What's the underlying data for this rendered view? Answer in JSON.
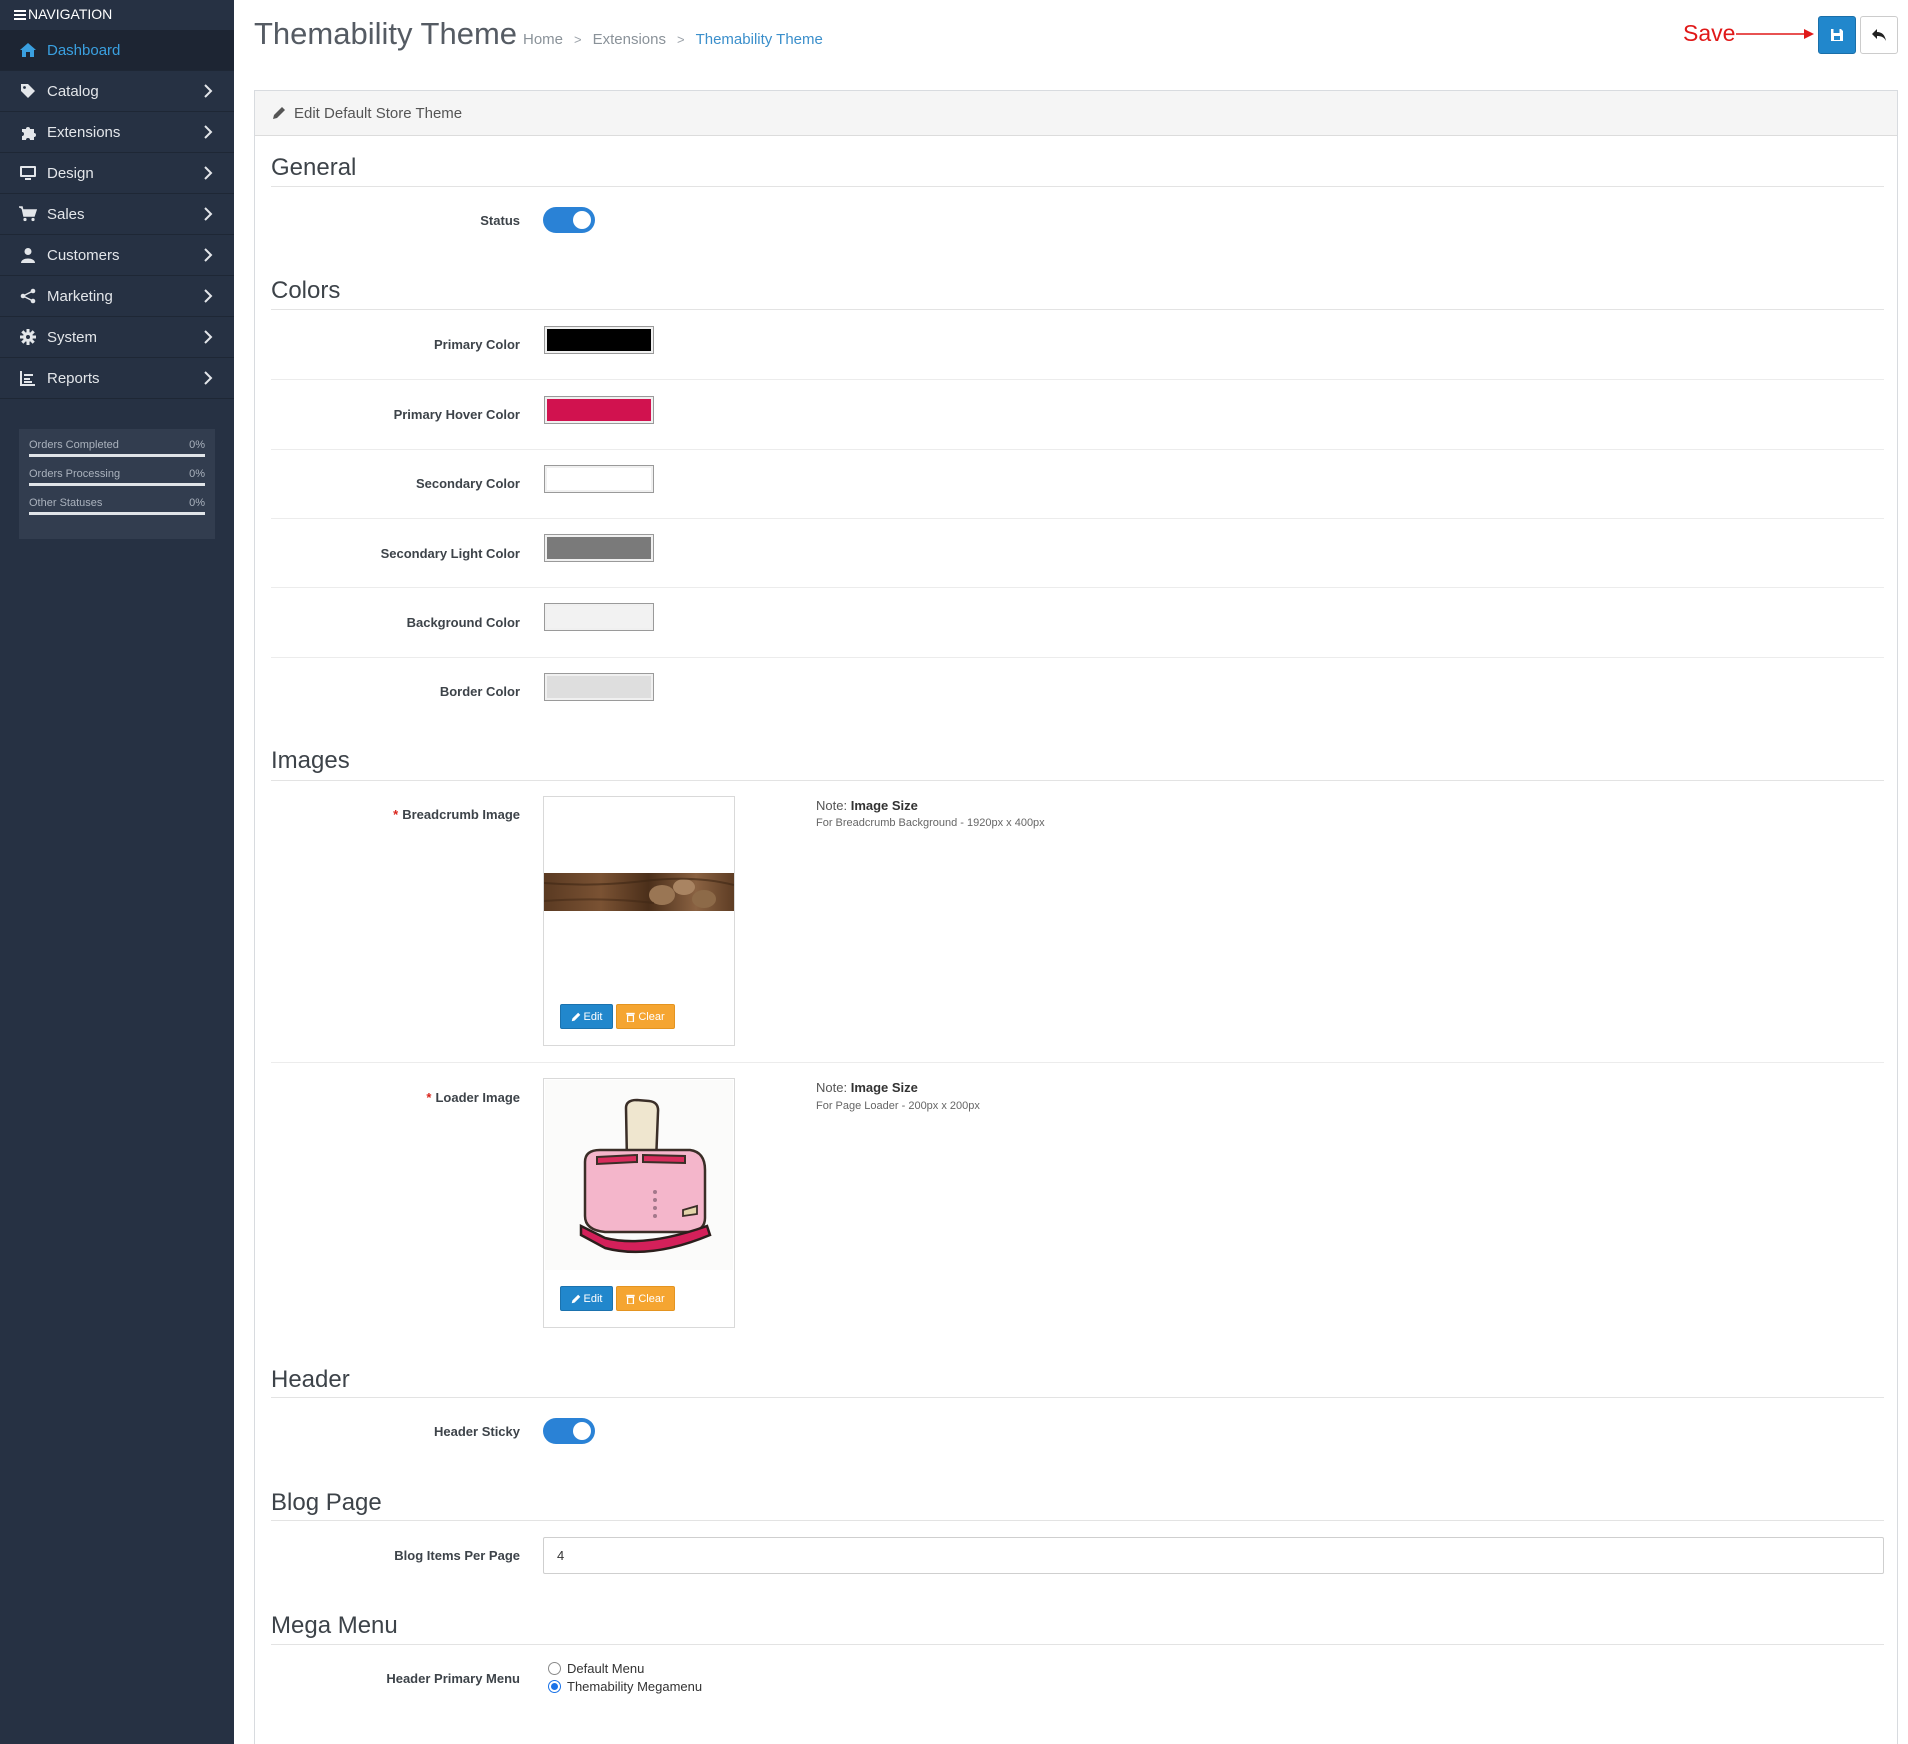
{
  "sidebar": {
    "title": "NAVIGATION",
    "items": [
      {
        "label": "Dashboard",
        "icon": "home-icon",
        "active": true
      },
      {
        "label": "Catalog",
        "icon": "tag-icon"
      },
      {
        "label": "Extensions",
        "icon": "puzzle-icon"
      },
      {
        "label": "Design",
        "icon": "monitor-icon"
      },
      {
        "label": "Sales",
        "icon": "cart-icon"
      },
      {
        "label": "Customers",
        "icon": "user-icon"
      },
      {
        "label": "Marketing",
        "icon": "share-icon"
      },
      {
        "label": "System",
        "icon": "gear-icon"
      },
      {
        "label": "Reports",
        "icon": "bar-chart-icon"
      }
    ],
    "stats": [
      {
        "label": "Orders Completed",
        "value": "0%",
        "progress": 0
      },
      {
        "label": "Orders Processing",
        "value": "0%",
        "progress": 0
      },
      {
        "label": "Other Statuses",
        "value": "0%",
        "progress": 0
      }
    ]
  },
  "header": {
    "title": "Themability Theme",
    "breadcrumb": [
      "Home",
      "Extensions",
      "Themability Theme"
    ],
    "save_annotation": "Save"
  },
  "panel": {
    "heading": "Edit Default Store Theme"
  },
  "general": {
    "title": "General",
    "status_label": "Status",
    "status_on": true
  },
  "colors": {
    "title": "Colors",
    "items": [
      {
        "label": "Primary Color",
        "value": "#000000"
      },
      {
        "label": "Primary Hover Color",
        "value": "#d1124f"
      },
      {
        "label": "Secondary Color",
        "value": "#ffffff"
      },
      {
        "label": "Secondary Light Color",
        "value": "#7a7a7a"
      },
      {
        "label": "Background Color",
        "value": "#f2f2f2"
      },
      {
        "label": "Border Color",
        "value": "#dedede"
      }
    ]
  },
  "images": {
    "title": "Images",
    "edit_label": "Edit",
    "clear_label": "Clear",
    "breadcrumb_image": {
      "label": "Breadcrumb Image",
      "note_prefix": "Note:",
      "note_bold": "Image Size",
      "note_detail": "For Breadcrumb Background - 1920px x 400px"
    },
    "loader_image": {
      "label": "Loader Image",
      "note_prefix": "Note:",
      "note_bold": "Image Size",
      "note_detail": "For Page Loader - 200px x 200px"
    }
  },
  "header_section": {
    "title": "Header",
    "sticky_label": "Header Sticky",
    "sticky_on": true
  },
  "blog": {
    "title": "Blog Page",
    "items_label": "Blog Items Per Page",
    "items_value": "4"
  },
  "mega_menu": {
    "title": "Mega Menu",
    "primary_label": "Header Primary Menu",
    "options": [
      "Default Menu",
      "Themability Megamenu"
    ],
    "selected": "Themability Megamenu"
  }
}
